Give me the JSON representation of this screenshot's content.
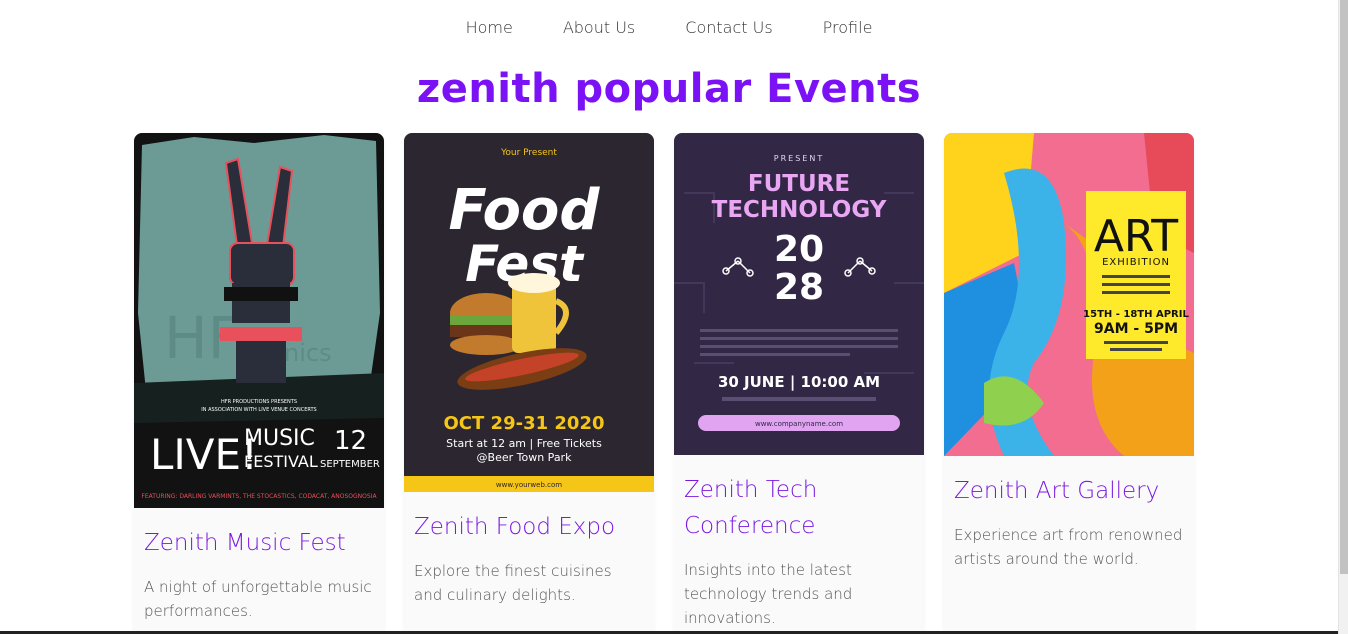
{
  "nav": {
    "items": [
      "Home",
      "About Us",
      "Contact Us",
      "Profile"
    ]
  },
  "page_title": "zenith popular Events",
  "colors": {
    "accent": "#7b12f5",
    "card_title": "#7a18e0"
  },
  "cards": [
    {
      "title": "Zenith Music Fest",
      "description": "A night of unforgettable music performances.",
      "poster": {
        "lines": [
          "LIVE!",
          "MUSIC",
          "FESTIVAL",
          "12",
          "SEPTEMBER"
        ],
        "small_text": [
          "HFR PRODUCTIONS PRESENTS",
          "IN ASSOCIATION WITH LIVE VENUE CONCERTS",
          "FEATURING: DARLING VARMINTS, THE STOCASTICS, CODACAT, ANOSOGNOSIA"
        ]
      }
    },
    {
      "title": "Zenith Food Expo",
      "description": "Explore the finest cuisines and culinary delights.",
      "poster": {
        "lines": [
          "Your Present",
          "Food",
          "Fest",
          "OCT 29-31 2020",
          "Start at 12 am | Free Tickets",
          "@Beer Town Park",
          "www.yourweb.com"
        ]
      }
    },
    {
      "title": "Zenith Tech Conference",
      "description": "Insights into the latest technology trends and innovations.",
      "poster": {
        "lines": [
          "PRESENT",
          "FUTURE",
          "TECHNOLOGY",
          "20",
          "28",
          "30 JUNE | 10:00 AM",
          "www.companyname.com"
        ]
      }
    },
    {
      "title": "Zenith Art Gallery",
      "description": "Experience art from renowned artists around the world.",
      "poster": {
        "lines": [
          "ART",
          "EXHIBITION",
          "15TH - 18TH APRIL",
          "9AM - 5PM"
        ]
      }
    }
  ]
}
